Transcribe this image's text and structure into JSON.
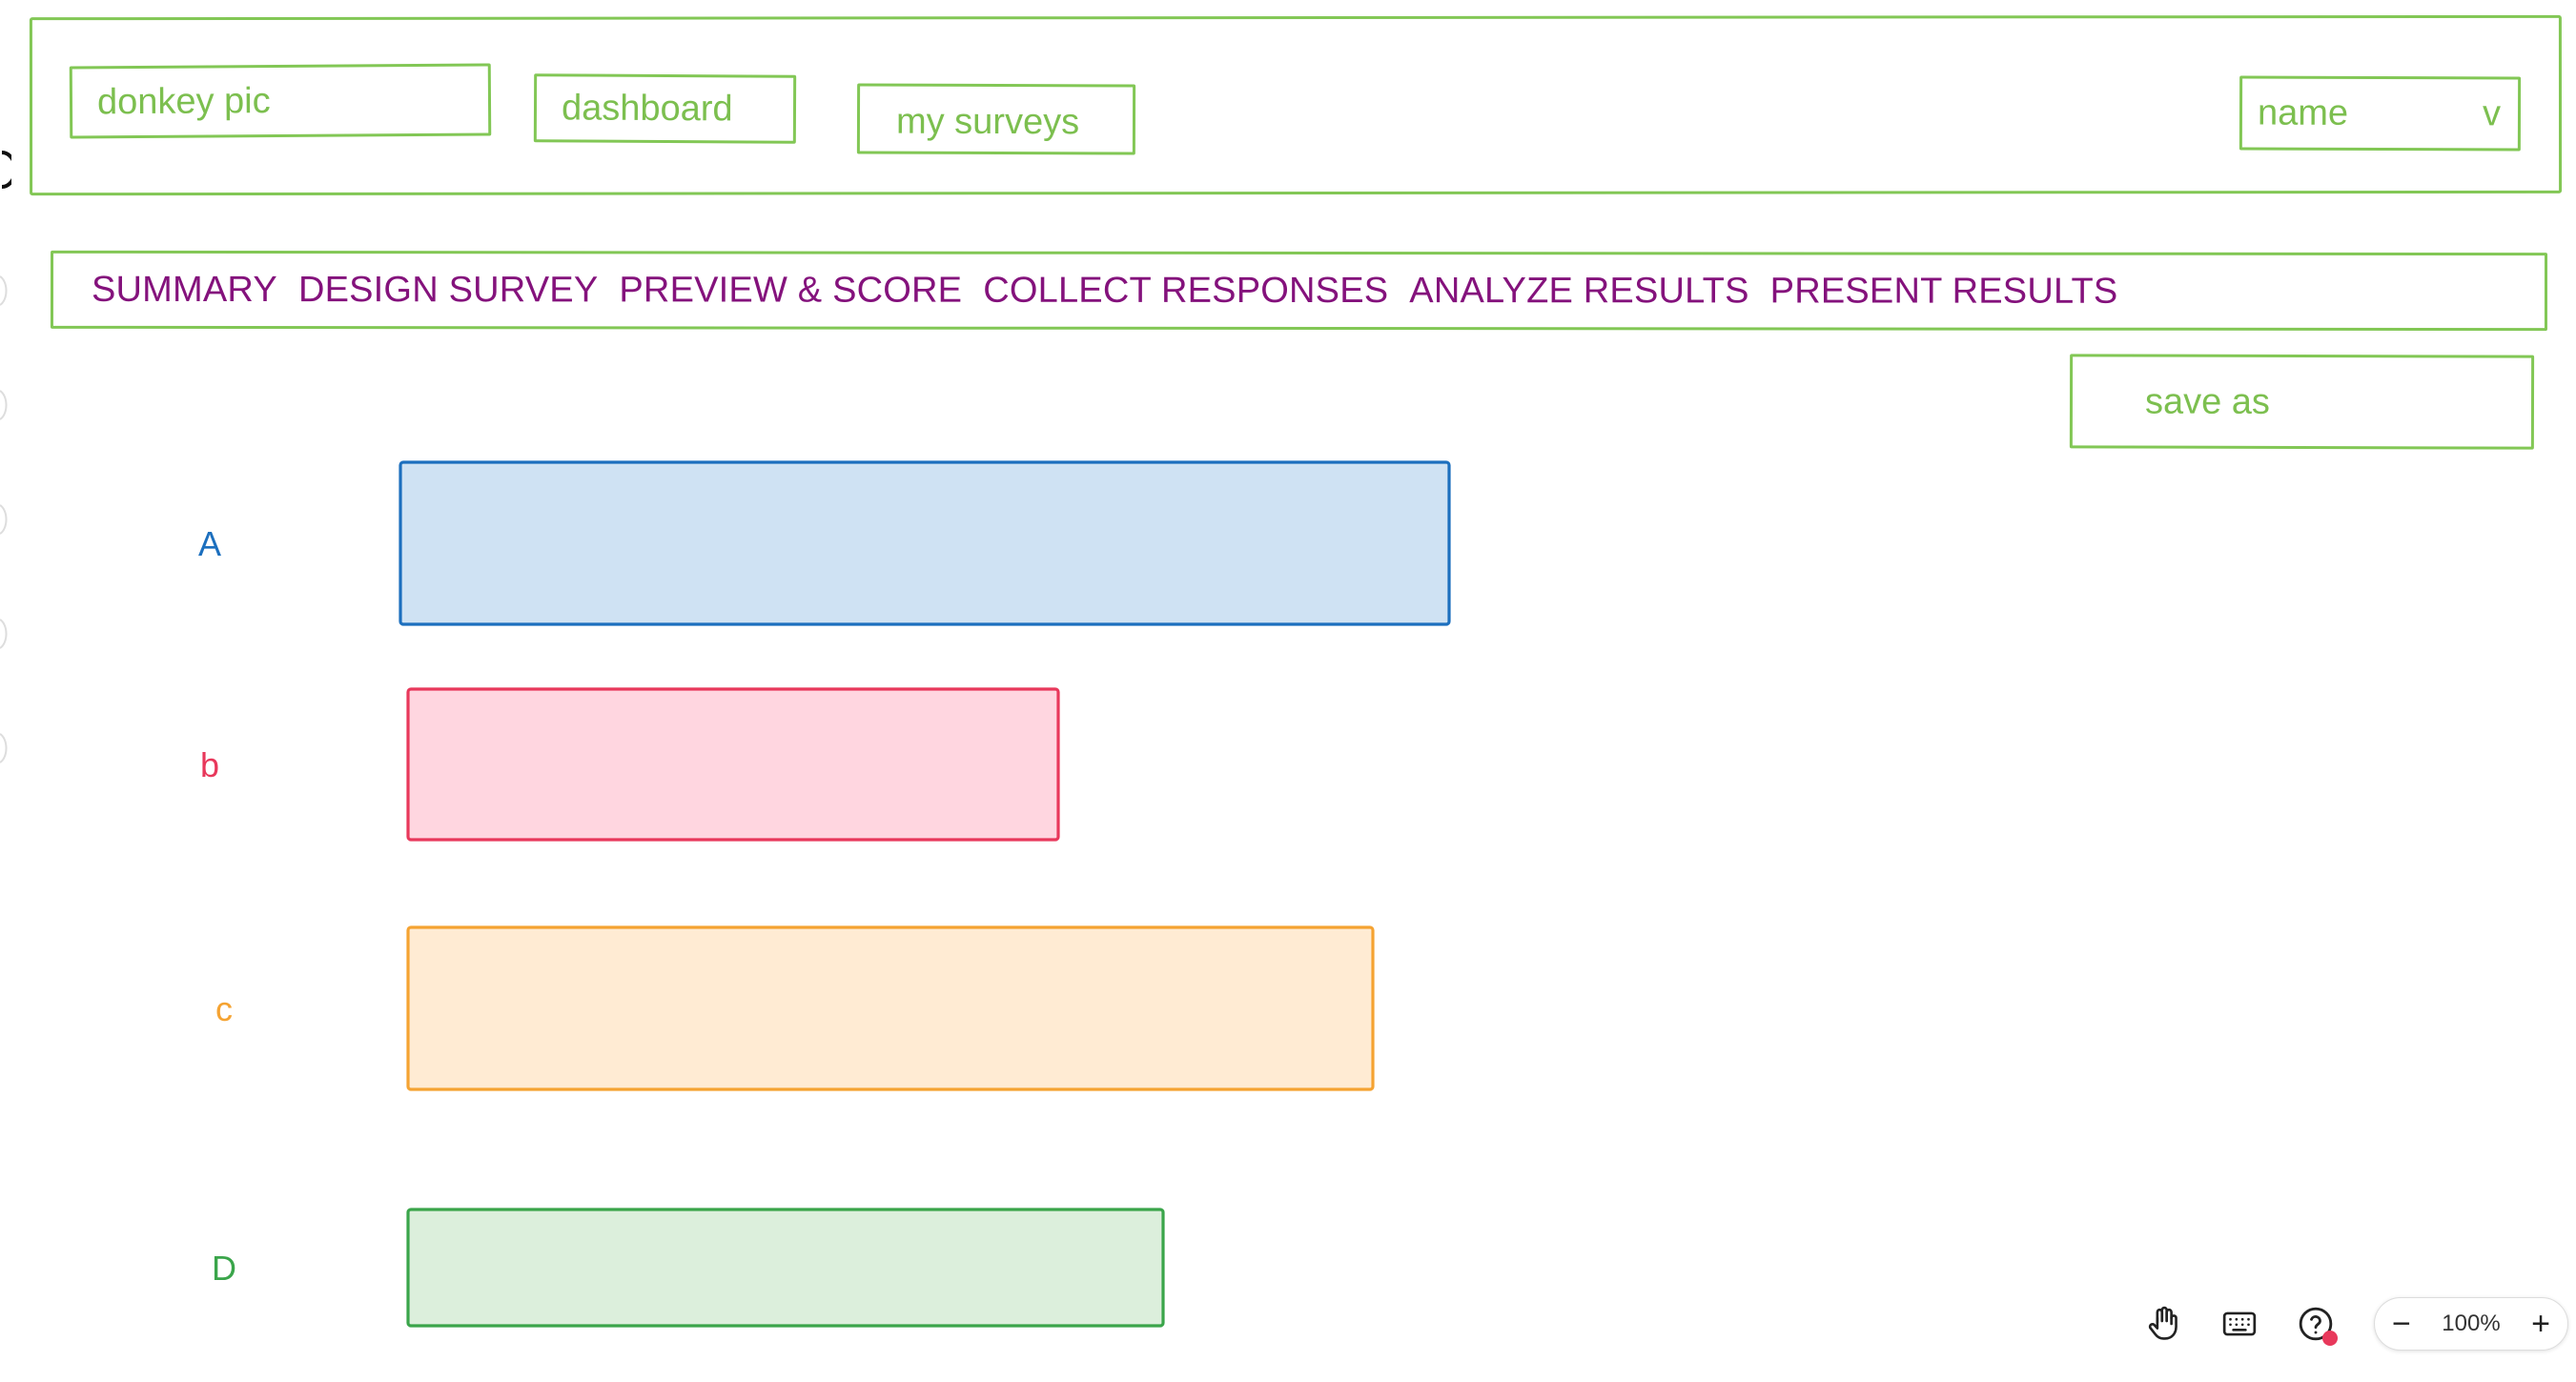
{
  "header": {
    "logo_label": "donkey pic",
    "dashboard_label": "dashboard",
    "surveys_label": "my surveys",
    "user_select": {
      "value": "name",
      "chevron": "v"
    }
  },
  "tabs": [
    {
      "label": "SUMMARY"
    },
    {
      "label": "DESIGN SURVEY"
    },
    {
      "label": "PREVIEW & SCORE"
    },
    {
      "label": "COLLECT RESPONSES"
    },
    {
      "label": "ANALYZE RESULTS"
    },
    {
      "label": "PRESENT RESULTS"
    }
  ],
  "actions": {
    "save_as_label": "save as"
  },
  "chart_data": {
    "type": "bar",
    "orientation": "horizontal",
    "categories": [
      "A",
      "b",
      "c",
      "D"
    ],
    "values": [
      100,
      62,
      92,
      72
    ],
    "xlim": [
      0,
      100
    ],
    "grid": false,
    "colors": {
      "A": {
        "fill": "#cfe2f3",
        "stroke": "#1c6fbe"
      },
      "b": {
        "fill": "#ffd6e0",
        "stroke": "#e8385b"
      },
      "c": {
        "fill": "#ffebd3",
        "stroke": "#f5a332"
      },
      "D": {
        "fill": "#dcefdc",
        "stroke": "#3aa54a"
      }
    }
  },
  "toolbar": {
    "hand_icon": "hand-icon",
    "keyboard_icon": "keyboard-icon",
    "help_icon": "help-icon",
    "zoom_out": "−",
    "zoom_level": "100%",
    "zoom_in": "+"
  },
  "colors": {
    "wireframe_green": "#82c755",
    "tab_purple": "#84127c"
  }
}
